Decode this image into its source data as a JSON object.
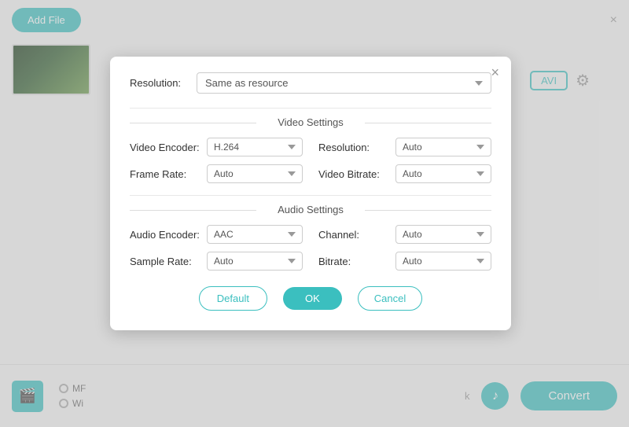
{
  "app": {
    "add_file_label": "Add File",
    "close_label": "×"
  },
  "format_area": {
    "avi_label": "AVI"
  },
  "bottom": {
    "convert_label": "Convert",
    "radio_items": [
      "MF",
      "Wi"
    ],
    "ok_partial": "k"
  },
  "modal": {
    "close_label": "×",
    "resolution_label": "Resolution:",
    "resolution_value": "Same as resource",
    "video_settings_title": "Video Settings",
    "audio_settings_title": "Audio Settings",
    "video_fields": [
      {
        "label": "Video Encoder:",
        "value": "H.264"
      },
      {
        "label": "Resolution:",
        "value": "Auto"
      },
      {
        "label": "Frame Rate:",
        "value": "Auto"
      },
      {
        "label": "Video Bitrate:",
        "value": "Auto"
      }
    ],
    "audio_fields": [
      {
        "label": "Audio Encoder:",
        "value": "AAC"
      },
      {
        "label": "Channel:",
        "value": "Auto"
      },
      {
        "label": "Sample Rate:",
        "value": "Auto"
      },
      {
        "label": "Bitrate:",
        "value": "Auto"
      }
    ],
    "default_label": "Default",
    "ok_label": "OK",
    "cancel_label": "Cancel"
  }
}
